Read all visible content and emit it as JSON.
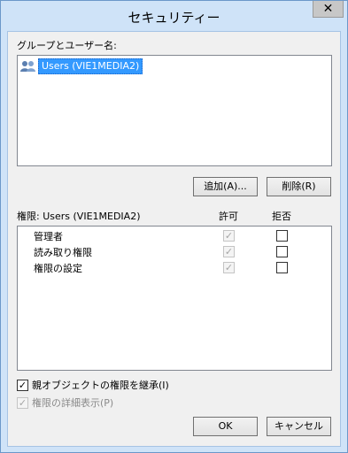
{
  "window": {
    "title": "セキュリティー",
    "close_label": "✕"
  },
  "groups": {
    "label": "グループとユーザー名:",
    "items": [
      {
        "label": "Users (VIE1MEDIA2)",
        "icon": "users-group-icon",
        "selected": true
      }
    ]
  },
  "buttons": {
    "add": "追加(A)...",
    "remove": "削除(R)",
    "ok": "OK",
    "cancel": "キャンセル"
  },
  "permissions": {
    "header": "権限: Users (VIE1MEDIA2)",
    "allow_header": "許可",
    "deny_header": "拒否",
    "rows": [
      {
        "label": "管理者",
        "allow": true,
        "allow_disabled": true,
        "deny": false
      },
      {
        "label": "読み取り権限",
        "allow": true,
        "allow_disabled": true,
        "deny": false
      },
      {
        "label": "権限の設定",
        "allow": true,
        "allow_disabled": true,
        "deny": false
      }
    ]
  },
  "inherit": {
    "label": "親オブジェクトの権限を継承(I)",
    "checked": true
  },
  "advanced": {
    "label": "権限の詳細表示(P)",
    "checked": true,
    "disabled": true
  },
  "colors": {
    "selection": "#3399ff",
    "frame": "#cfe3f8"
  }
}
